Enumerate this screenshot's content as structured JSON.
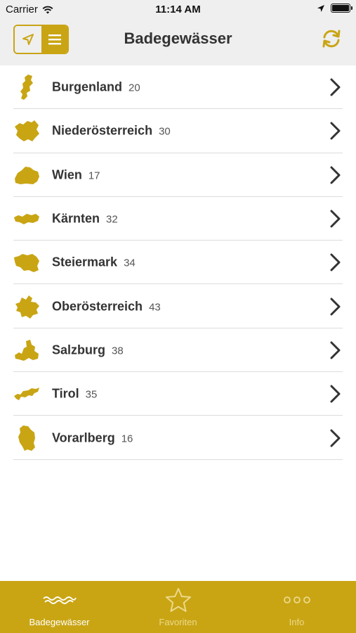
{
  "status_bar": {
    "carrier": "Carrier",
    "time": "11:14 AM"
  },
  "nav": {
    "title": "Badegewässer"
  },
  "regions": [
    {
      "name": "Burgenland",
      "count": "20"
    },
    {
      "name": "Niederösterreich",
      "count": "30"
    },
    {
      "name": "Wien",
      "count": "17"
    },
    {
      "name": "Kärnten",
      "count": "32"
    },
    {
      "name": "Steiermark",
      "count": "34"
    },
    {
      "name": "Oberösterreich",
      "count": "43"
    },
    {
      "name": "Salzburg",
      "count": "38"
    },
    {
      "name": "Tirol",
      "count": "35"
    },
    {
      "name": "Vorarlberg",
      "count": "16"
    }
  ],
  "tabs": [
    {
      "label": "Badegewässer",
      "icon": "waves-icon",
      "active": true
    },
    {
      "label": "Favoriten",
      "icon": "star-icon",
      "active": false
    },
    {
      "label": "Info",
      "icon": "more-dots-icon",
      "active": false
    }
  ],
  "colors": {
    "accent": "#c9a514",
    "nav_background": "#efefef",
    "text": "#333333"
  }
}
